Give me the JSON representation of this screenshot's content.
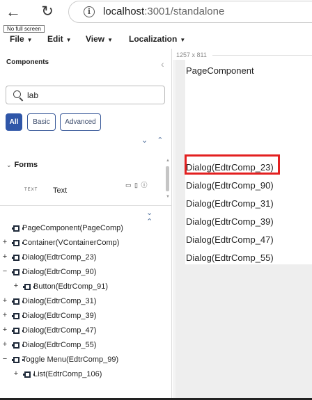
{
  "browser": {
    "back_glyph": "←",
    "reload_glyph": "↻",
    "info_glyph": "i",
    "url_host": "localhost",
    "url_rest": ":3001/standalone"
  },
  "app": {
    "no_full_screen": "No full screen",
    "menus": [
      {
        "label": "File"
      },
      {
        "label": "Edit"
      },
      {
        "label": "View"
      },
      {
        "label": "Localization"
      }
    ]
  },
  "components_panel": {
    "title": "Components",
    "collapse_glyph": "‹",
    "search_value": "lab",
    "filters": [
      "All",
      "Basic",
      "Advanced"
    ],
    "active_filter": "All",
    "arrows": "⌄ ⌃",
    "section": {
      "caret": "⌄",
      "title": "Forms"
    },
    "item": {
      "preview": "TEXT",
      "label": "Text",
      "icons": "▭ ▯ ⓘ"
    }
  },
  "tree": {
    "arrows": "⌄ ⌃",
    "nodes": [
      {
        "toggle": "",
        "label": "PageComponent(PageComp)",
        "depth": 0
      },
      {
        "toggle": "+",
        "label": "Container(VContainerComp)",
        "depth": 0
      },
      {
        "toggle": "+",
        "label": "Dialog(EdtrComp_23)",
        "depth": 0
      },
      {
        "toggle": "−",
        "label": "Dialog(EdtrComp_90)",
        "depth": 0
      },
      {
        "toggle": "+",
        "label": "Button(EdtrComp_91)",
        "depth": 1
      },
      {
        "toggle": "+",
        "label": "Dialog(EdtrComp_31)",
        "depth": 0
      },
      {
        "toggle": "+",
        "label": "Dialog(EdtrComp_39)",
        "depth": 0
      },
      {
        "toggle": "+",
        "label": "Dialog(EdtrComp_47)",
        "depth": 0
      },
      {
        "toggle": "+",
        "label": "Dialog(EdtrComp_55)",
        "depth": 0
      },
      {
        "toggle": "−",
        "label": "Toggle Menu(EdtrComp_99)",
        "depth": 0
      },
      {
        "toggle": "+",
        "label": "List(EdtrComp_106)",
        "depth": 1
      }
    ]
  },
  "canvas": {
    "size_label": "1257 x 811",
    "page_title": "PageComponent",
    "dialogs": [
      "Dialog(EdtrComp_23)",
      "Dialog(EdtrComp_90)",
      "Dialog(EdtrComp_31)",
      "Dialog(EdtrComp_39)",
      "Dialog(EdtrComp_47)",
      "Dialog(EdtrComp_55)"
    ],
    "selected_index": 0,
    "highlight_color": "#e32020"
  }
}
